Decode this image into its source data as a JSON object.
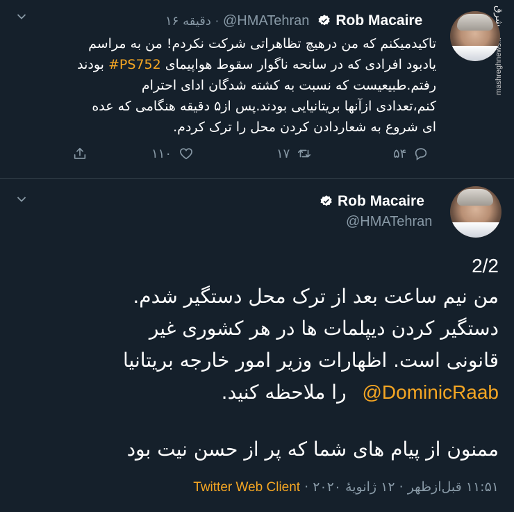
{
  "parent_tweet": {
    "author_name": "Rob Macaire",
    "handle": "@HMATehran",
    "time": "۱۶ دقیقه",
    "text_lines": [
      "تاکیدمیکنم که من درهیچ تظاهراتی شرکت نکردم! من به مراسم",
      "یادبود افرادی که در سانحه ناگوار سقوط هواپیمای",
      "رفتم.طبیعیست که نسبت به کشته شدگان ادای احترام",
      "کنم،تعدادی ازآنها بریتانیایی بودند.پس از۵ دقیقه هنگامی که عده",
      "ای شروع به شعاردادن کردن محل را ترک کردم."
    ],
    "hashtag": "#PS752",
    "after_hashtag": "بودند",
    "replies": "۵۴",
    "retweets": "۱۷",
    "likes": "۱۱۰"
  },
  "main_tweet": {
    "author_name": "Rob Macaire",
    "handle": "@HMATehran",
    "thread_index": "2/2",
    "lines": [
      "من نیم ساعت بعد از ترک محل دستگیر شدم.",
      "دستگیر کردن دیپلمات ها در هر کشوری غیر",
      "قانونی است. اظهارات وزیر امور خارجه بریتانیا",
      "را ملاحظه کنید."
    ],
    "mention": "@DominicRaab",
    "closing": "ممنون از پیام های شما که پر از حسن نیت بود",
    "timestamp": "۱۱:۵۱ قبل‌ازظهر · ۱۲ ژانویهٔ ۲۰۲۰ · ",
    "client": "Twitter Web Client"
  },
  "watermark": {
    "logo": "مشرق",
    "url": "mashreghnews.ir"
  },
  "colors": {
    "background": "#15202b",
    "accent": "#f5a623",
    "muted": "#8899a6"
  }
}
